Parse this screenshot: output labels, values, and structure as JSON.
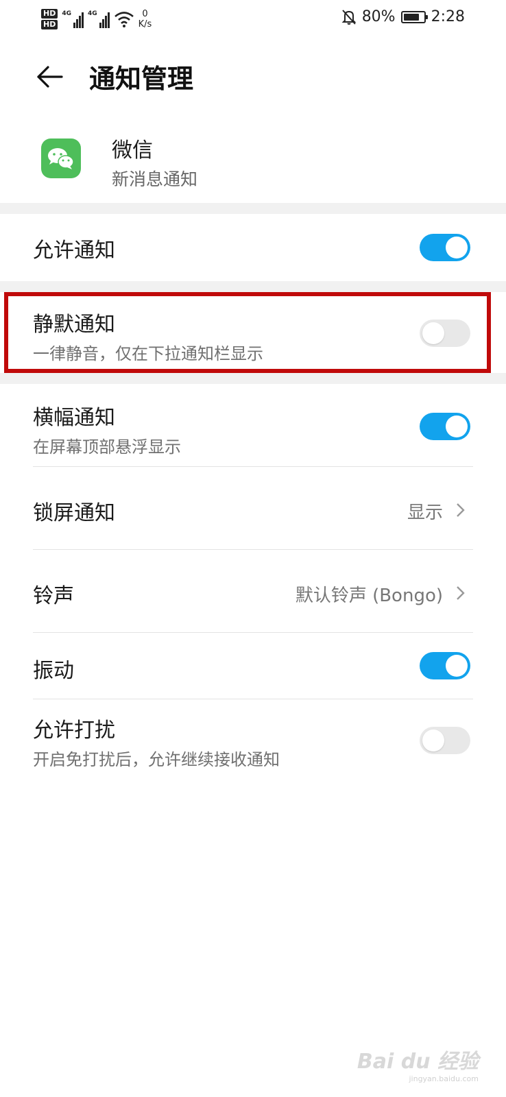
{
  "status_bar": {
    "hd1": "HD",
    "hd2": "HD",
    "net1": "4G",
    "net2": "4G",
    "speed_value": "0",
    "speed_unit": "K/s",
    "battery_percent": "80%",
    "battery_level": 0.8,
    "time": "2:28"
  },
  "header": {
    "title": "通知管理"
  },
  "app": {
    "name": "微信",
    "subtitle": "新消息通知",
    "icon_color": "#4ebe5a"
  },
  "settings": {
    "allow_notifications": {
      "label": "允许通知",
      "enabled": true
    },
    "silent_notifications": {
      "label": "静默通知",
      "description": "一律静音，仅在下拉通知栏显示",
      "enabled": false
    },
    "banner_notifications": {
      "label": "横幅通知",
      "description": "在屏幕顶部悬浮显示",
      "enabled": true
    },
    "lock_screen": {
      "label": "锁屏通知",
      "value": "显示"
    },
    "ringtone": {
      "label": "铃声",
      "value": "默认铃声 (Bongo)"
    },
    "vibration": {
      "label": "振动",
      "enabled": true
    },
    "allow_dnd": {
      "label": "允许打扰",
      "description": "开启免打扰后，允许继续接收通知",
      "enabled": false
    }
  },
  "colors": {
    "toggle_on": "#12a3ed",
    "toggle_off": "#e8e8e8",
    "highlight": "#c00a0a"
  },
  "watermark": {
    "text": "Bai du 经验",
    "sub": "jingyan.baidu.com"
  }
}
